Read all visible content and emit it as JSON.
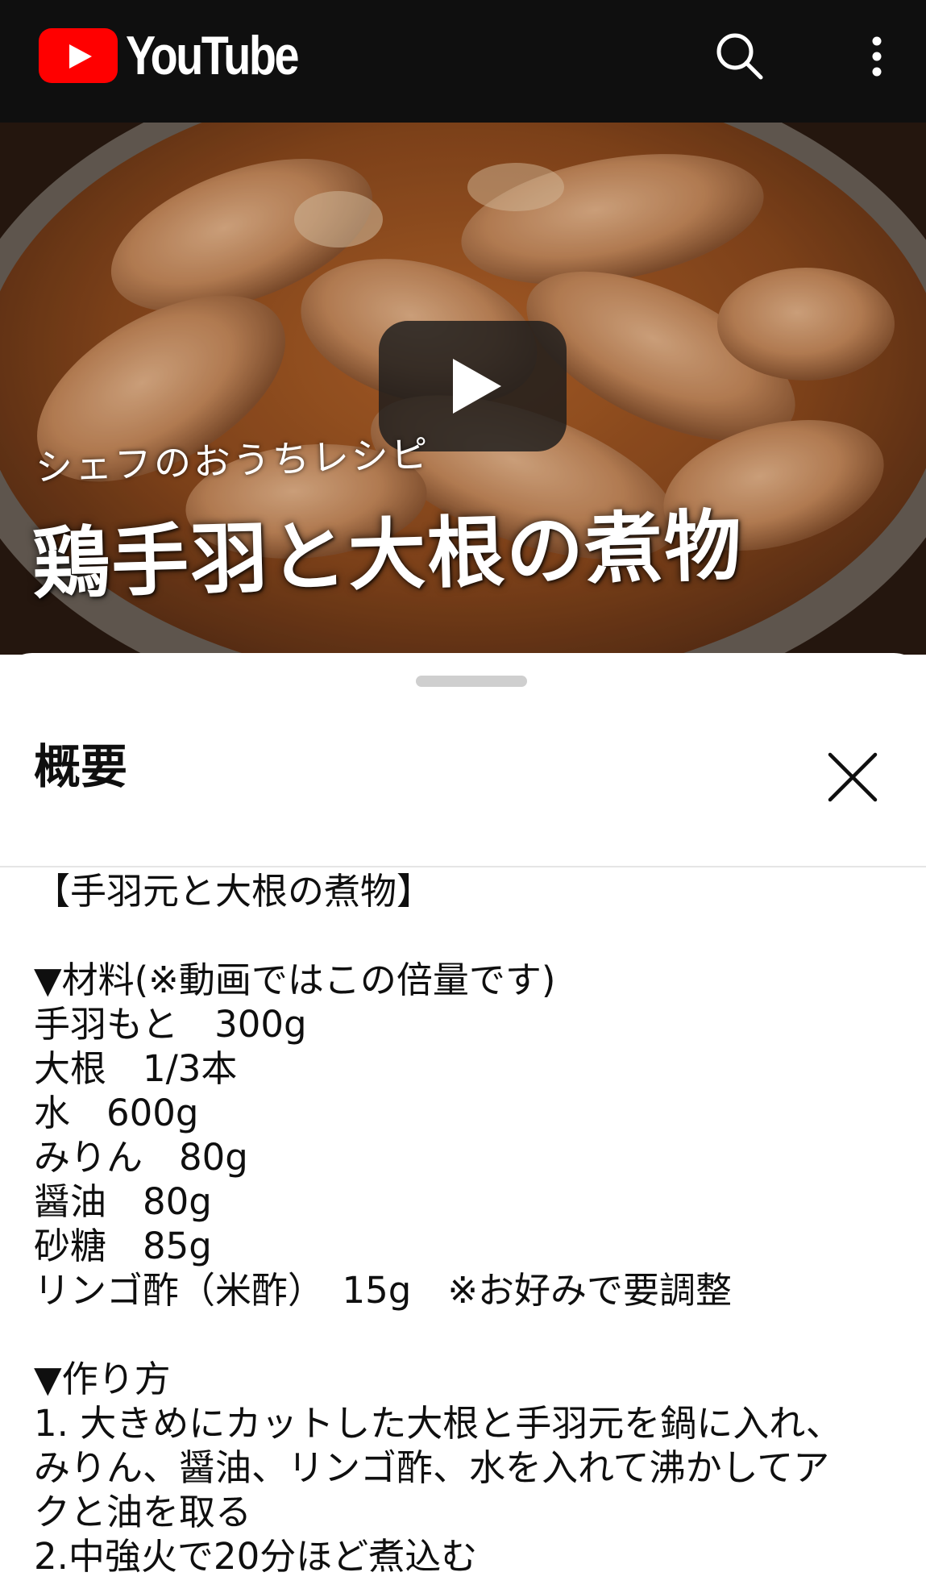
{
  "topbar": {
    "logo_text": "YouTube",
    "icons": {
      "logo": "youtube-play-icon",
      "search": "search-icon",
      "more": "more-vertical-icon"
    }
  },
  "video": {
    "overlay_subtitle": "シェフのおうちレシピ",
    "overlay_title": "鶏手羽と大根の煮物",
    "play_icon": "play-icon"
  },
  "sheet": {
    "title": "概要",
    "close_icon": "close-icon",
    "description": {
      "heading": "【手羽元と大根の煮物】",
      "ingredients_header": "▼材料(※動画ではこの倍量です)",
      "ingredients": [
        "手羽もと　300g",
        "大根　1/3本",
        "水　600g",
        "みりん　80g",
        "醤油　80g",
        "砂糖　85g",
        "リンゴ酢（米酢）　15g　※お好みで要調整"
      ],
      "method_header": "▼作り方",
      "method_lines": [
        "1. 大きめにカットした大根と手羽元を鍋に入れ、",
        "みりん、醤油、リンゴ酢、水を入れて沸かしてア",
        "クと油を取る",
        "2.中強火で20分ほど煮込む"
      ]
    }
  },
  "colors": {
    "topbar_bg": "#0f0f0f",
    "logo_red": "#ff0000",
    "text": "#0f0f0f",
    "handle": "#cfcfcf",
    "divider": "#e5e5e5"
  }
}
